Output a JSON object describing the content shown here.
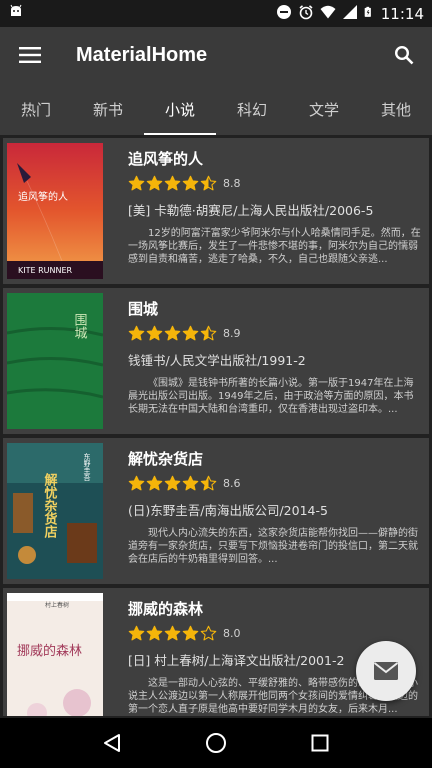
{
  "status_bar": {
    "time": "11:14"
  },
  "app_bar": {
    "title": "MaterialHome"
  },
  "tabs": [
    {
      "label": "热门"
    },
    {
      "label": "新书"
    },
    {
      "label": "小说"
    },
    {
      "label": "科幻"
    },
    {
      "label": "文学"
    },
    {
      "label": "其他"
    }
  ],
  "active_tab": "小说",
  "books": [
    {
      "title": "追风筝的人",
      "rating": 8.8,
      "rating_text": "8.8",
      "meta": "[美] 卡勒德·胡赛尼/上海人民出版社/2006-5",
      "desc": "12岁的阿富汗富家少爷阿米尔与仆人哈桑情同手足。然而，在一场风筝比赛后，发生了一件悲惨不堪的事，阿米尔为自己的懦弱感到自责和痛苦，逃走了哈桑，不久，自己也跟随父亲逃...",
      "cover_title": "追风筝的人",
      "cover_sub": "KITE RUNNER"
    },
    {
      "title": "围城",
      "rating": 8.9,
      "rating_text": "8.9",
      "meta": "钱锺书/人民文学出版社/1991-2",
      "desc": "《围城》是钱钟书所著的长篇小说。第一版于1947年在上海晨光出版公司出版。1949年之后，由于政治等方面的原因，本书长期无法在中国大陆和台湾重印，仅在香港出现过盗印本。...",
      "cover_title": "围城"
    },
    {
      "title": "解忧杂货店",
      "rating": 8.6,
      "rating_text": "8.6",
      "meta": "(日)东野圭吾/南海出版公司/2014-5",
      "desc": "现代人内心流失的东西，这家杂货店能帮你找回——僻静的街道旁有一家杂货店，只要写下烦恼投进卷帘门的投信口，第二天就会在店后的牛奶箱里得到回答。...",
      "cover_title": "解忧杂货店",
      "cover_author": "东野圭吾"
    },
    {
      "title": "挪威的森林",
      "rating": 8.0,
      "rating_text": "8.0",
      "meta": "[日] 村上春树/上海译文出版社/2001-2",
      "desc": "这是一部动人心弦的、平缓舒雅的、略带感伤的恋爱小说。小说主人公渡边以第一人称展开他同两个女孩间的爱情纠葛。渡边的第一个恋人直子原是他高中要好同学木月的女友，后来木月...",
      "cover_title": "挪威的森林",
      "cover_author": "村上春树"
    }
  ],
  "colors": {
    "app_bar": "#3a3a3a",
    "background": "#212121",
    "card": "#3f3f3f",
    "star": "#f5b50a"
  },
  "icons": {
    "menu": "hamburger-icon",
    "search": "search-icon",
    "fab": "mail-icon",
    "nav_back": "back-triangle-icon",
    "nav_home": "home-circle-icon",
    "nav_recent": "recent-square-icon"
  }
}
